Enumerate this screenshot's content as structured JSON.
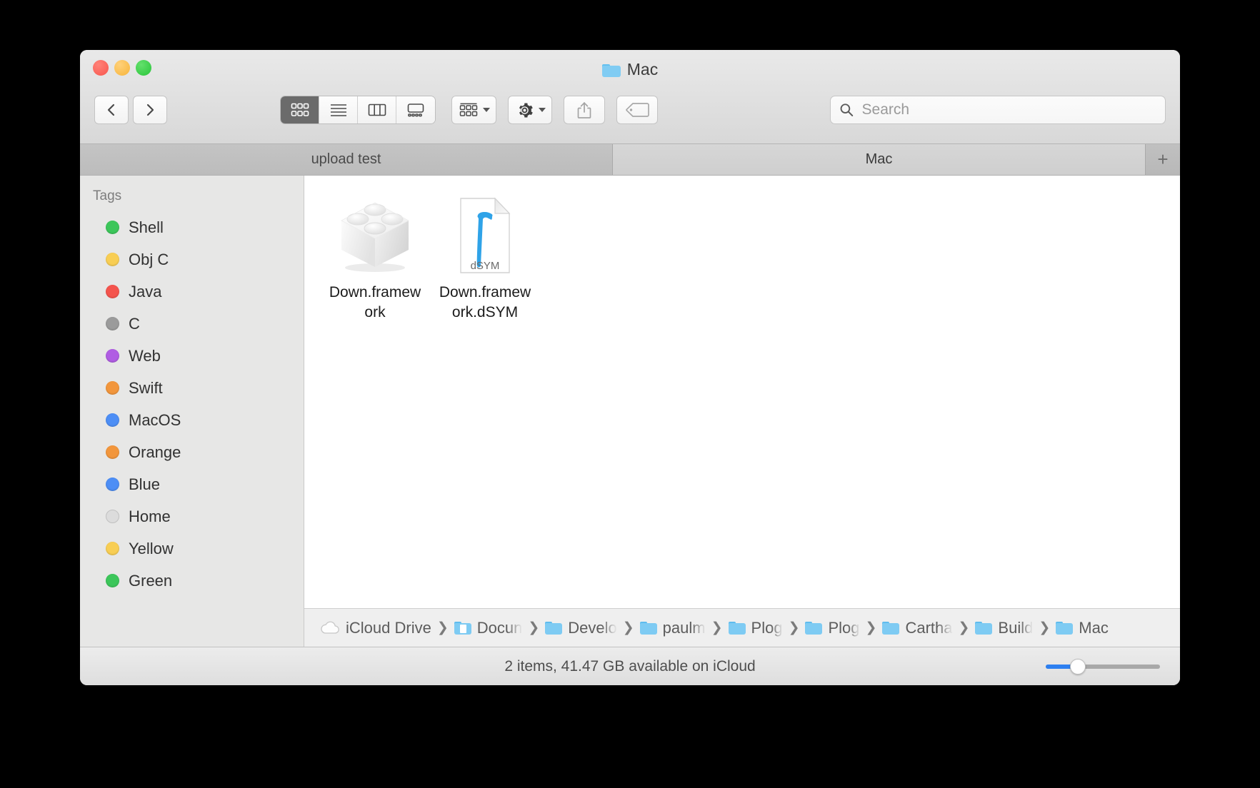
{
  "window": {
    "title": "Mac",
    "title_icon": "folder-icon",
    "traffic_lights": [
      {
        "name": "close",
        "color": "#f8564c"
      },
      {
        "name": "minimize",
        "color": "#f7b43a"
      },
      {
        "name": "zoom",
        "color": "#2ac53a"
      }
    ]
  },
  "toolbar": {
    "back_icon": "chevron-left-icon",
    "forward_icon": "chevron-right-icon",
    "view_modes": [
      {
        "id": "icon",
        "label": "Icon View",
        "icon": "grid-icon",
        "active": true
      },
      {
        "id": "list",
        "label": "List View",
        "icon": "list-icon",
        "active": false
      },
      {
        "id": "column",
        "label": "Column View",
        "icon": "columns-icon",
        "active": false
      },
      {
        "id": "gallery",
        "label": "Gallery View",
        "icon": "gallery-icon",
        "active": false
      }
    ],
    "arrange_icon": "grid-icon",
    "action_icon": "gear-icon",
    "share_icon": "share-icon",
    "tag_icon": "tag-icon"
  },
  "search": {
    "placeholder": "Search",
    "value": "",
    "icon": "search-icon"
  },
  "tabs": {
    "items": [
      {
        "label": "upload test",
        "active": false
      },
      {
        "label": "Mac",
        "active": true
      }
    ],
    "add_label": "+"
  },
  "sidebar": {
    "header": "Tags",
    "items": [
      {
        "label": "Shell",
        "color": "#3cc65a",
        "hollow": false
      },
      {
        "label": "Obj C",
        "color": "#f8ce54",
        "hollow": false
      },
      {
        "label": "Java",
        "color": "#f4544d",
        "hollow": false
      },
      {
        "label": "C",
        "color": "#9b9b9b",
        "hollow": false
      },
      {
        "label": "Web",
        "color": "#b05de3",
        "hollow": false
      },
      {
        "label": "Swift",
        "color": "#f2963c",
        "hollow": false
      },
      {
        "label": "MacOS",
        "color": "#4d8ef5",
        "hollow": false
      },
      {
        "label": "Orange",
        "color": "#f2963c",
        "hollow": false
      },
      {
        "label": "Blue",
        "color": "#4d8ef5",
        "hollow": false
      },
      {
        "label": "Home",
        "color": "#dcdcdc",
        "hollow": true
      },
      {
        "label": "Yellow",
        "color": "#f8ce54",
        "hollow": false
      },
      {
        "label": "Green",
        "color": "#3cc65a",
        "hollow": false
      }
    ]
  },
  "files": [
    {
      "name": "Down.framework",
      "icon": "framework-brick-icon",
      "badge": ""
    },
    {
      "name": "Down.framework.dSYM",
      "icon": "dsym-document-icon",
      "badge": "dSYM"
    }
  ],
  "pathbar": [
    {
      "label": "iCloud Drive",
      "icon": "cloud-icon"
    },
    {
      "label": "Docun",
      "icon": "document-folder-icon"
    },
    {
      "label": "Develo",
      "icon": "folder-icon"
    },
    {
      "label": "paulm",
      "icon": "folder-icon"
    },
    {
      "label": "Plog",
      "icon": "folder-icon"
    },
    {
      "label": "Plog",
      "icon": "folder-icon"
    },
    {
      "label": "Cartha",
      "icon": "folder-icon"
    },
    {
      "label": "Build",
      "icon": "folder-icon"
    },
    {
      "label": "Mac",
      "icon": "folder-icon"
    }
  ],
  "statusbar": {
    "text": "2 items, 41.47 GB available on iCloud",
    "zoom_value": 22
  },
  "colors": {
    "accent": "#2d7ff0",
    "window_bg": "#ececec",
    "sidebar_bg": "#e7e7e6",
    "content_bg": "#ffffff",
    "folder_blue": "#7ecbf3"
  }
}
